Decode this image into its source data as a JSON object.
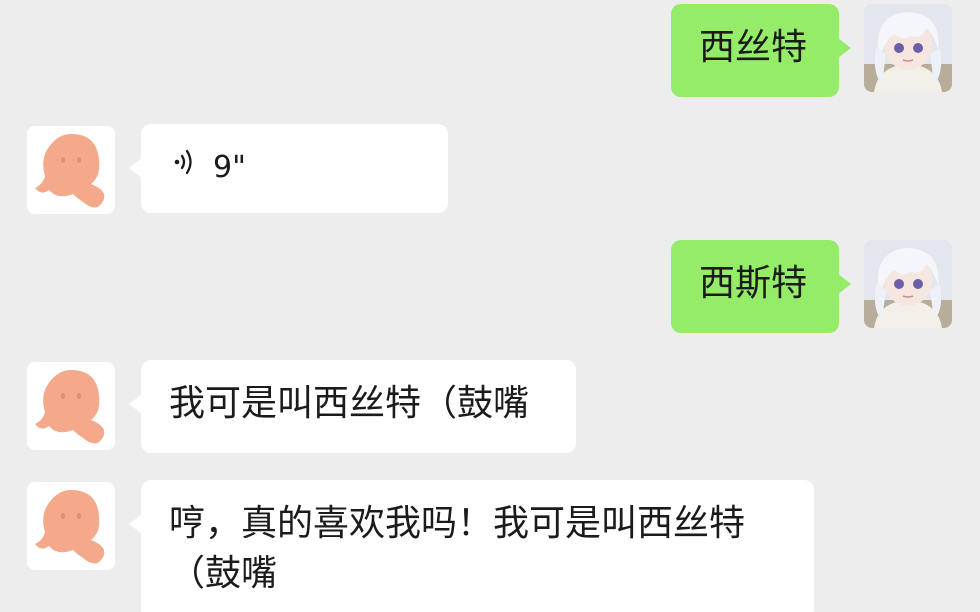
{
  "colors": {
    "background": "#ededed",
    "outgoing_bubble": "#95ec69",
    "incoming_bubble": "#ffffff",
    "contact_avatar": "#f5a98b"
  },
  "messages": [
    {
      "direction": "outgoing",
      "avatar": "anime-girl-avatar",
      "type": "text",
      "text": "西丝特"
    },
    {
      "direction": "incoming",
      "avatar": "orange-blob-avatar",
      "type": "voice",
      "duration": "9\""
    },
    {
      "direction": "outgoing",
      "avatar": "anime-girl-avatar",
      "type": "text",
      "text": "西斯特"
    },
    {
      "direction": "incoming",
      "avatar": "orange-blob-avatar",
      "type": "text",
      "text": "我可是叫西丝特（鼓嘴"
    },
    {
      "direction": "incoming",
      "avatar": "orange-blob-avatar",
      "type": "text",
      "lines": [
        "哼，真的喜欢我吗！我可是叫西丝特",
        "（鼓嘴"
      ]
    }
  ]
}
